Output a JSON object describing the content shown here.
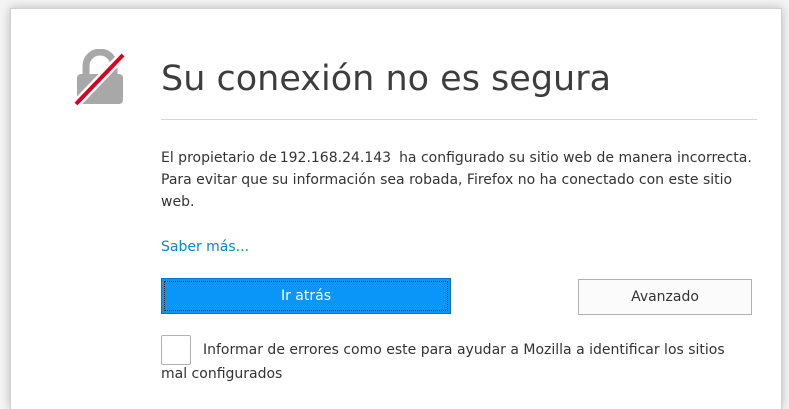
{
  "error_page": {
    "title": "Su conexión no es segura",
    "description": {
      "before_host": "El propietario de",
      "host": "192.168.24.143",
      "after_host": "ha configurado su sitio web de manera incorrecta. Para evitar que su información sea robada, Firefox no ha conectado con este sitio web."
    },
    "learn_more_label": "Saber más...",
    "go_back_label": "Ir atrás",
    "advanced_label": "Avanzado",
    "report_label": "Informar de errores como este para ayudar a Mozilla a identificar los sitios mal configurados",
    "report_checked": false
  },
  "icon": {
    "name": "broken-lock-icon"
  },
  "colors": {
    "accent": "#0996f8",
    "link": "#0a84d6",
    "lock_gray": "#a8a8a8",
    "lock_slash": "#d70022"
  }
}
